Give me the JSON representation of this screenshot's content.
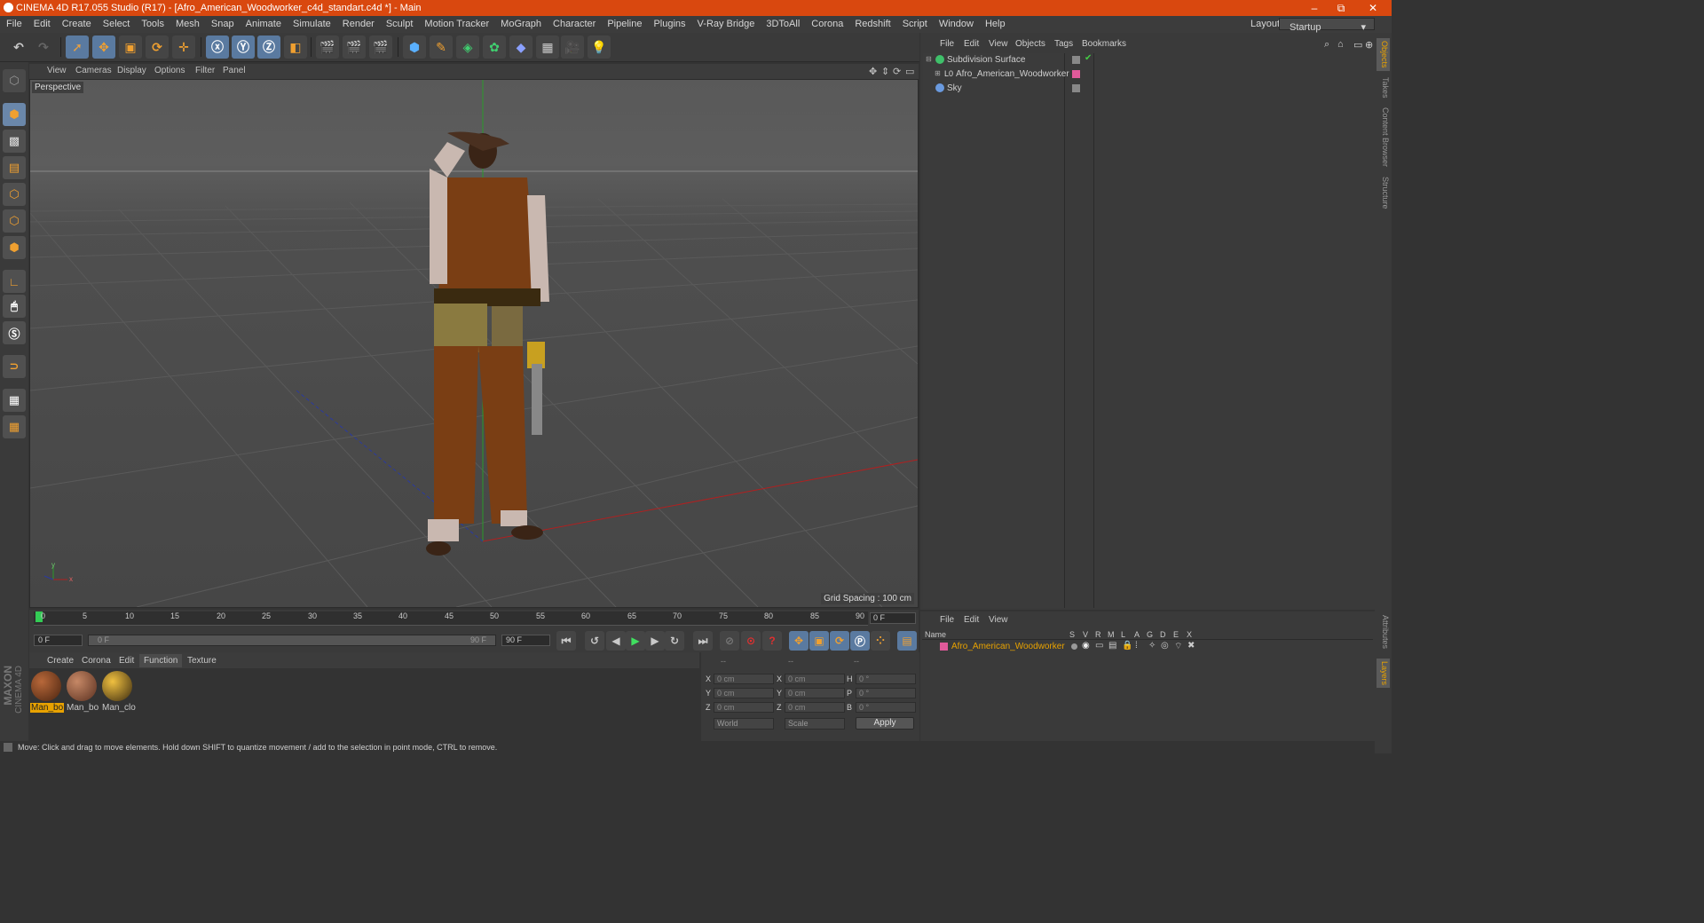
{
  "titlebar": {
    "title": "CINEMA 4D R17.055 Studio (R17) - [Afro_American_Woodworker_c4d_standart.c4d *] - Main",
    "minimize": "–",
    "maximize": "⧉",
    "close": "✕"
  },
  "menus": [
    "File",
    "Edit",
    "Create",
    "Select",
    "Tools",
    "Mesh",
    "Snap",
    "Animate",
    "Simulate",
    "Render",
    "Sculpt",
    "Motion Tracker",
    "MoGraph",
    "Character",
    "Pipeline",
    "Plugins",
    "V-Ray Bridge",
    "3DToAll",
    "Corona",
    "Redshift",
    "Script",
    "Window",
    "Help"
  ],
  "layout": {
    "label": "Layout:",
    "value": "Startup"
  },
  "viewport": {
    "menu": [
      "View",
      "Cameras",
      "Display",
      "Options",
      "Filter",
      "Panel"
    ],
    "label": "Perspective",
    "grid_spacing": "Grid Spacing : 100 cm",
    "axis_y": "y",
    "axis_x": "x"
  },
  "timeline": {
    "ticks": [
      "0",
      "5",
      "10",
      "15",
      "20",
      "25",
      "30",
      "35",
      "40",
      "45",
      "50",
      "55",
      "60",
      "65",
      "70",
      "75",
      "80",
      "85",
      "90"
    ],
    "current": "0 F",
    "start": "0 F",
    "slider_start": "0 F",
    "slider_end": "90 F",
    "end": "90 F"
  },
  "materials": {
    "menu": [
      "Create",
      "Corona",
      "Edit",
      "Function",
      "Texture"
    ],
    "active_tab": "Function",
    "items": [
      {
        "name": "Man_bo",
        "color": "#6b3b1e"
      },
      {
        "name": "Man_bo",
        "color": "#7a4b35"
      },
      {
        "name": "Man_clo",
        "color": "#c8a030"
      }
    ]
  },
  "coords": {
    "headers": [
      "--",
      "--",
      "--"
    ],
    "rows": [
      {
        "a": "X",
        "av": "0 cm",
        "b": "X",
        "bv": "0 cm",
        "c": "H",
        "cv": "0 °"
      },
      {
        "a": "Y",
        "av": "0 cm",
        "b": "Y",
        "bv": "0 cm",
        "c": "P",
        "cv": "0 °"
      },
      {
        "a": "Z",
        "av": "0 cm",
        "b": "Z",
        "bv": "0 cm",
        "c": "B",
        "cv": "0 °"
      }
    ],
    "world": "World",
    "scale": "Scale",
    "apply": "Apply"
  },
  "status": "Move: Click and drag to move elements. Hold down SHIFT to quantize movement / add to the selection in point mode, CTRL to remove.",
  "objects": {
    "menu": [
      "File",
      "Edit",
      "View",
      "Objects",
      "Tags",
      "Bookmarks"
    ],
    "items": [
      "Subdivision Surface",
      "Afro_American_Woodworker",
      "Sky"
    ]
  },
  "layers": {
    "menu": [
      "File",
      "Edit",
      "View"
    ],
    "columns": [
      "Name",
      "S",
      "V",
      "R",
      "M",
      "L",
      "A",
      "G",
      "D",
      "E",
      "X"
    ],
    "items": [
      "Afro_American_Woodworker"
    ]
  },
  "right_tabs": [
    "Objects",
    "Takes",
    "Content Browser",
    "Structure",
    "Attributes",
    "Layers"
  ],
  "brand": {
    "maxon": "MAXON",
    "c4d": "CINEMA 4D"
  },
  "colors": {
    "accent": "#d9480f",
    "layer_tag": "#e05a9a",
    "highlight_text": "#e8a200"
  }
}
